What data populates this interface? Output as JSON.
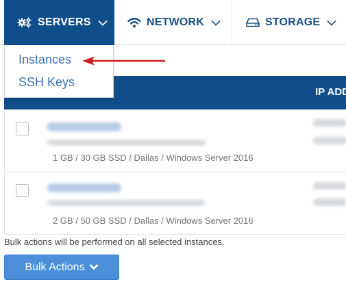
{
  "nav": {
    "servers": {
      "label": "SERVERS",
      "icon": "cogs-icon"
    },
    "network": {
      "label": "NETWORK",
      "icon": "wifi-icon"
    },
    "storage": {
      "label": "STORAGE",
      "icon": "hard-drive-icon"
    }
  },
  "dropdown": {
    "items": [
      {
        "label": "Instances"
      },
      {
        "label": "SSH Keys"
      }
    ]
  },
  "table": {
    "columns": {
      "ip": "IP ADD"
    },
    "rows": [
      {
        "spec": "1 GB / 30 GB SSD / Dallas / Windows Server 2016"
      },
      {
        "spec": "2 GB / 50 GB SSD / Dallas / Windows Server 2016"
      }
    ]
  },
  "footer": {
    "note": "Bulk actions will be performed on all selected instances.",
    "bulk_button": "Bulk Actions"
  },
  "colors": {
    "nav_active": "#104e8b",
    "nav_text": "#1a4f85",
    "link": "#3a71b5",
    "annotation_arrow": "#d0191f",
    "button": "#4a8fd8"
  }
}
